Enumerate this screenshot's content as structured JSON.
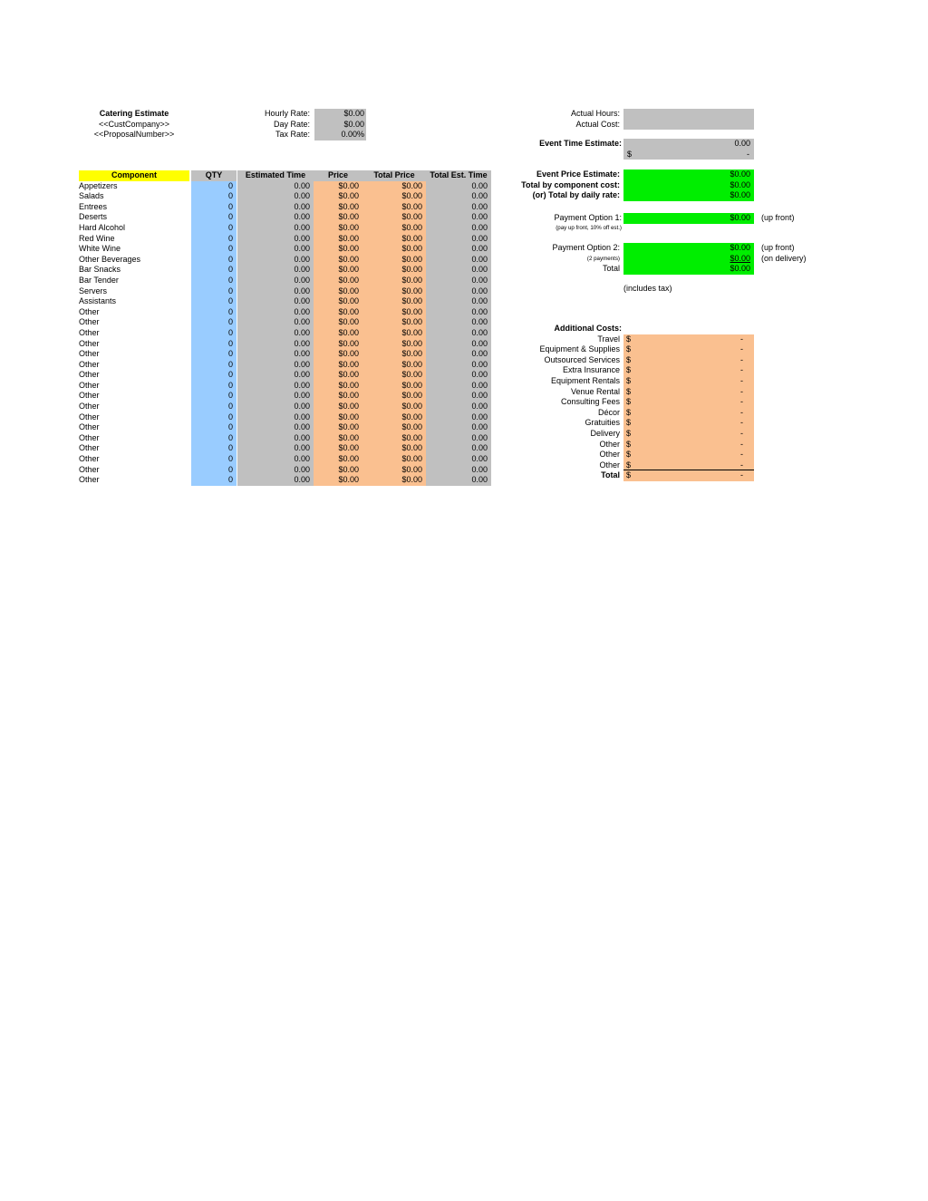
{
  "title_block": {
    "heading": "Catering Estimate",
    "cust_company": "<<CustCompany>>",
    "proposal_number": "<<ProposalNumber>>"
  },
  "rates": {
    "labels": [
      "Hourly Rate:",
      "Day Rate:",
      "Tax Rate:"
    ],
    "values": [
      "$0.00",
      "$0.00",
      "0.00%"
    ]
  },
  "actuals": {
    "labels": [
      "Actual Hours:",
      "Actual Cost:"
    ],
    "values": [
      "",
      ""
    ]
  },
  "event_estimate": {
    "time_label": "Event Time Estimate:",
    "time_value": "0.00",
    "dollar_symbol": "$",
    "dollar_value": "-",
    "price_labels": [
      "Event Price Estimate:",
      "Total by component cost:",
      "(or) Total by daily rate:"
    ],
    "price_values": [
      "$0.00",
      "$0.00",
      "$0.00"
    ]
  },
  "payment_option_1": {
    "label": "Payment Option 1:",
    "value": "$0.00",
    "note": "(pay up front, 10% off est.)",
    "side_note": "(up front)"
  },
  "payment_option_2": {
    "labels": [
      "Payment Option 2:",
      "(2 payments)",
      "Total"
    ],
    "values": [
      "$0.00",
      "$0.00",
      "$0.00"
    ],
    "side_notes": [
      "(up front)",
      "(on delivery)"
    ],
    "includes_tax": "(includes tax)"
  },
  "additional_costs": {
    "title": "Additional Costs:",
    "rows": [
      {
        "label": "Travel",
        "symbol": "$",
        "amount": "-"
      },
      {
        "label": "Equipment & Supplies",
        "symbol": "$",
        "amount": "-"
      },
      {
        "label": "Outsourced Services",
        "symbol": "$",
        "amount": "-"
      },
      {
        "label": "Extra Insurance",
        "symbol": "$",
        "amount": "-"
      },
      {
        "label": "Equipment Rentals",
        "symbol": "$",
        "amount": "-"
      },
      {
        "label": "Venue Rental",
        "symbol": "$",
        "amount": "-"
      },
      {
        "label": "Consulting Fees",
        "symbol": "$",
        "amount": "-"
      },
      {
        "label": "Décor",
        "symbol": "$",
        "amount": "-"
      },
      {
        "label": "Gratuities",
        "symbol": "$",
        "amount": "-"
      },
      {
        "label": "Delivery",
        "symbol": "$",
        "amount": "-"
      },
      {
        "label": "Other",
        "symbol": "$",
        "amount": "-"
      },
      {
        "label": "Other",
        "symbol": "$",
        "amount": "-"
      },
      {
        "label": "Other",
        "symbol": "$",
        "amount": "-"
      },
      {
        "label": "Total",
        "symbol": "$",
        "amount": "-"
      }
    ]
  },
  "component_table": {
    "columns": [
      "Component",
      "QTY",
      "Estimated Time",
      "Price",
      "Total Price",
      "Total Est. Time"
    ],
    "rows": [
      {
        "component": "Appetizers",
        "qty": "0",
        "est_time": "0.00",
        "price": "$0.00",
        "total_price": "$0.00",
        "total_est_time": "0.00"
      },
      {
        "component": "Salads",
        "qty": "0",
        "est_time": "0.00",
        "price": "$0.00",
        "total_price": "$0.00",
        "total_est_time": "0.00"
      },
      {
        "component": "Entrees",
        "qty": "0",
        "est_time": "0.00",
        "price": "$0.00",
        "total_price": "$0.00",
        "total_est_time": "0.00"
      },
      {
        "component": "Deserts",
        "qty": "0",
        "est_time": "0.00",
        "price": "$0.00",
        "total_price": "$0.00",
        "total_est_time": "0.00"
      },
      {
        "component": "Hard Alcohol",
        "qty": "0",
        "est_time": "0.00",
        "price": "$0.00",
        "total_price": "$0.00",
        "total_est_time": "0.00"
      },
      {
        "component": "Red Wine",
        "qty": "0",
        "est_time": "0.00",
        "price": "$0.00",
        "total_price": "$0.00",
        "total_est_time": "0.00"
      },
      {
        "component": "White Wine",
        "qty": "0",
        "est_time": "0.00",
        "price": "$0.00",
        "total_price": "$0.00",
        "total_est_time": "0.00"
      },
      {
        "component": "Other Beverages",
        "qty": "0",
        "est_time": "0.00",
        "price": "$0.00",
        "total_price": "$0.00",
        "total_est_time": "0.00"
      },
      {
        "component": "Bar Snacks",
        "qty": "0",
        "est_time": "0.00",
        "price": "$0.00",
        "total_price": "$0.00",
        "total_est_time": "0.00"
      },
      {
        "component": "Bar Tender",
        "qty": "0",
        "est_time": "0.00",
        "price": "$0.00",
        "total_price": "$0.00",
        "total_est_time": "0.00"
      },
      {
        "component": "Servers",
        "qty": "0",
        "est_time": "0.00",
        "price": "$0.00",
        "total_price": "$0.00",
        "total_est_time": "0.00"
      },
      {
        "component": "Assistants",
        "qty": "0",
        "est_time": "0.00",
        "price": "$0.00",
        "total_price": "$0.00",
        "total_est_time": "0.00"
      },
      {
        "component": "Other",
        "qty": "0",
        "est_time": "0.00",
        "price": "$0.00",
        "total_price": "$0.00",
        "total_est_time": "0.00"
      },
      {
        "component": "Other",
        "qty": "0",
        "est_time": "0.00",
        "price": "$0.00",
        "total_price": "$0.00",
        "total_est_time": "0.00"
      },
      {
        "component": "Other",
        "qty": "0",
        "est_time": "0.00",
        "price": "$0.00",
        "total_price": "$0.00",
        "total_est_time": "0.00"
      },
      {
        "component": "Other",
        "qty": "0",
        "est_time": "0.00",
        "price": "$0.00",
        "total_price": "$0.00",
        "total_est_time": "0.00"
      },
      {
        "component": "Other",
        "qty": "0",
        "est_time": "0.00",
        "price": "$0.00",
        "total_price": "$0.00",
        "total_est_time": "0.00"
      },
      {
        "component": "Other",
        "qty": "0",
        "est_time": "0.00",
        "price": "$0.00",
        "total_price": "$0.00",
        "total_est_time": "0.00"
      },
      {
        "component": "Other",
        "qty": "0",
        "est_time": "0.00",
        "price": "$0.00",
        "total_price": "$0.00",
        "total_est_time": "0.00"
      },
      {
        "component": "Other",
        "qty": "0",
        "est_time": "0.00",
        "price": "$0.00",
        "total_price": "$0.00",
        "total_est_time": "0.00"
      },
      {
        "component": "Other",
        "qty": "0",
        "est_time": "0.00",
        "price": "$0.00",
        "total_price": "$0.00",
        "total_est_time": "0.00"
      },
      {
        "component": "Other",
        "qty": "0",
        "est_time": "0.00",
        "price": "$0.00",
        "total_price": "$0.00",
        "total_est_time": "0.00"
      },
      {
        "component": "Other",
        "qty": "0",
        "est_time": "0.00",
        "price": "$0.00",
        "total_price": "$0.00",
        "total_est_time": "0.00"
      },
      {
        "component": "Other",
        "qty": "0",
        "est_time": "0.00",
        "price": "$0.00",
        "total_price": "$0.00",
        "total_est_time": "0.00"
      },
      {
        "component": "Other",
        "qty": "0",
        "est_time": "0.00",
        "price": "$0.00",
        "total_price": "$0.00",
        "total_est_time": "0.00"
      },
      {
        "component": "Other",
        "qty": "0",
        "est_time": "0.00",
        "price": "$0.00",
        "total_price": "$0.00",
        "total_est_time": "0.00"
      },
      {
        "component": "Other",
        "qty": "0",
        "est_time": "0.00",
        "price": "$0.00",
        "total_price": "$0.00",
        "total_est_time": "0.00"
      },
      {
        "component": "Other",
        "qty": "0",
        "est_time": "0.00",
        "price": "$0.00",
        "total_price": "$0.00",
        "total_est_time": "0.00"
      },
      {
        "component": "Other",
        "qty": "0",
        "est_time": "0.00",
        "price": "$0.00",
        "total_price": "$0.00",
        "total_est_time": "0.00"
      }
    ]
  },
  "colors": {
    "header_yellow": "#ffff00",
    "qty_blue": "#99ccff",
    "value_gray": "#c0c0c0",
    "price_orange": "#fac090",
    "total_green": "#00ee00"
  }
}
